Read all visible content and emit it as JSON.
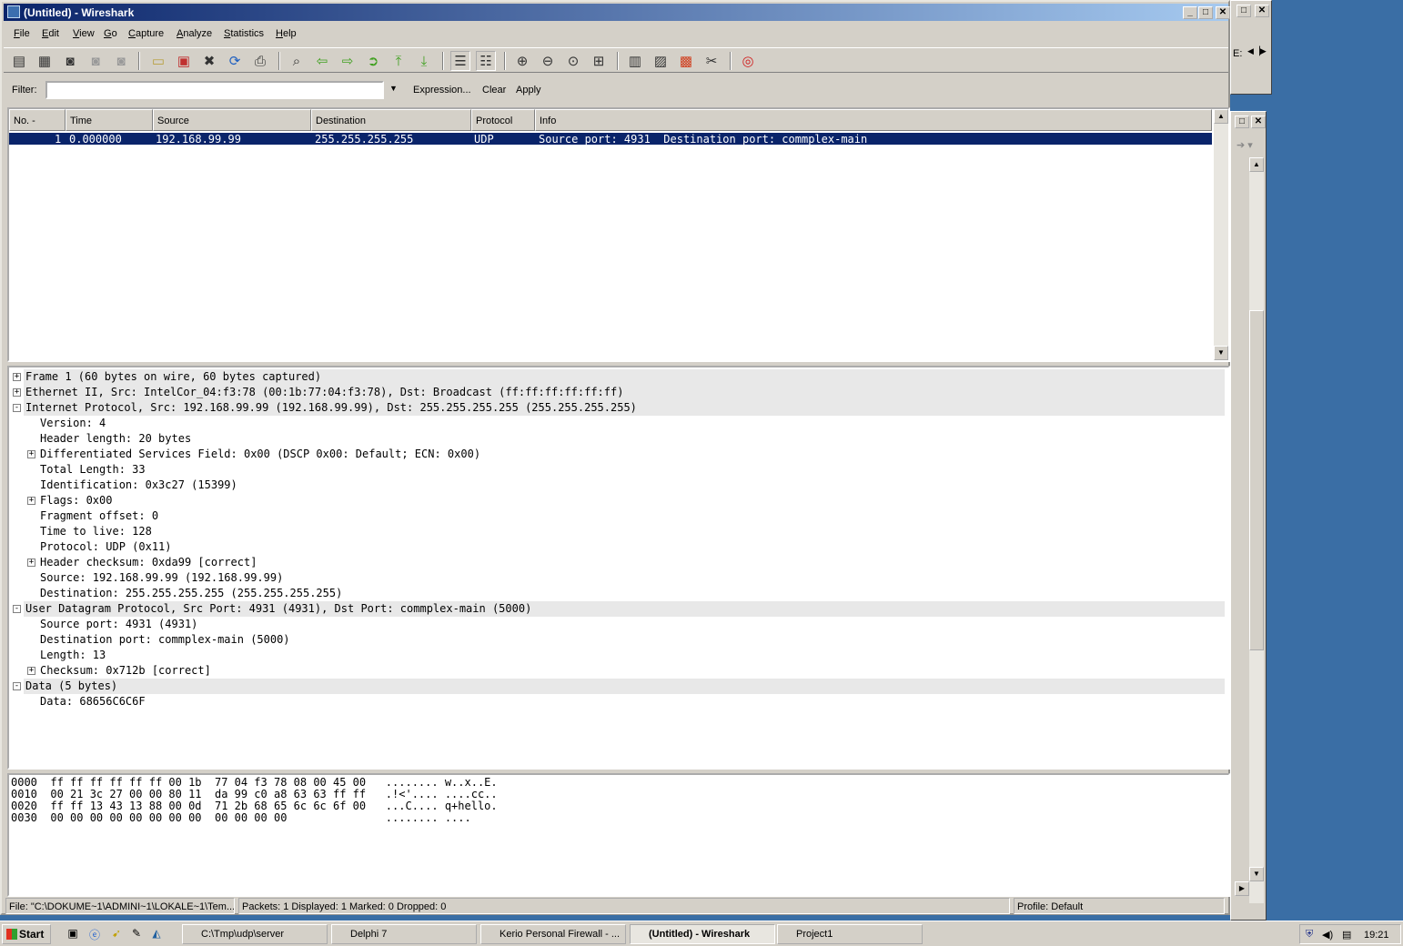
{
  "window": {
    "title": "(Untitled) - Wireshark"
  },
  "menu": [
    "File",
    "Edit",
    "View",
    "Go",
    "Capture",
    "Analyze",
    "Statistics",
    "Help"
  ],
  "toolbar_icons": [
    "interface-list-icon",
    "capture-options-icon",
    "capture-start-icon",
    "capture-stop-icon",
    "capture-restart-icon",
    "open-icon",
    "save-icon",
    "close-icon",
    "reload-icon",
    "print-icon",
    "find-icon",
    "go-back-icon",
    "go-forward-icon",
    "go-to-packet-icon",
    "go-first-icon",
    "go-last-icon",
    "colorize-icon",
    "auto-scroll-icon",
    "zoom-in-icon",
    "zoom-out-icon",
    "zoom-normal-icon",
    "resize-columns-icon",
    "capture-filters-icon",
    "display-filters-icon",
    "coloring-rules-icon",
    "preferences-icon",
    "help-icon"
  ],
  "filter": {
    "label": "Filter:",
    "value": "",
    "expression": "Expression...",
    "clear": "Clear",
    "apply": "Apply"
  },
  "packet_list": {
    "columns": [
      "No. -",
      "Time",
      "Source",
      "Destination",
      "Protocol",
      "Info"
    ],
    "rows": [
      {
        "no": "1",
        "time": "0.000000",
        "source": "192.168.99.99",
        "destination": "255.255.255.255",
        "protocol": "UDP",
        "info": "Source port: 4931  Destination port: commplex-main"
      }
    ]
  },
  "details": [
    {
      "text": "Frame 1 (60 bytes on wire, 60 bytes captured)",
      "level": 0,
      "toggle": "+",
      "hl": true
    },
    {
      "text": "Ethernet II, Src: IntelCor_04:f3:78 (00:1b:77:04:f3:78), Dst: Broadcast (ff:ff:ff:ff:ff:ff)",
      "level": 0,
      "toggle": "+",
      "hl": true
    },
    {
      "text": "Internet Protocol, Src: 192.168.99.99 (192.168.99.99), Dst: 255.255.255.255 (255.255.255.255)",
      "level": 0,
      "toggle": "-",
      "hl": true
    },
    {
      "text": "Version: 4",
      "level": 1,
      "toggle": ""
    },
    {
      "text": "Header length: 20 bytes",
      "level": 1,
      "toggle": ""
    },
    {
      "text": "Differentiated Services Field: 0x00 (DSCP 0x00: Default; ECN: 0x00)",
      "level": 1,
      "toggle": "+"
    },
    {
      "text": "Total Length: 33",
      "level": 1,
      "toggle": ""
    },
    {
      "text": "Identification: 0x3c27 (15399)",
      "level": 1,
      "toggle": ""
    },
    {
      "text": "Flags: 0x00",
      "level": 1,
      "toggle": "+"
    },
    {
      "text": "Fragment offset: 0",
      "level": 1,
      "toggle": ""
    },
    {
      "text": "Time to live: 128",
      "level": 1,
      "toggle": ""
    },
    {
      "text": "Protocol: UDP (0x11)",
      "level": 1,
      "toggle": ""
    },
    {
      "text": "Header checksum: 0xda99 [correct]",
      "level": 1,
      "toggle": "+"
    },
    {
      "text": "Source: 192.168.99.99 (192.168.99.99)",
      "level": 1,
      "toggle": ""
    },
    {
      "text": "Destination: 255.255.255.255 (255.255.255.255)",
      "level": 1,
      "toggle": ""
    },
    {
      "text": "User Datagram Protocol, Src Port: 4931 (4931), Dst Port: commplex-main (5000)",
      "level": 0,
      "toggle": "-",
      "hl": true
    },
    {
      "text": "Source port: 4931 (4931)",
      "level": 1,
      "toggle": ""
    },
    {
      "text": "Destination port: commplex-main (5000)",
      "level": 1,
      "toggle": ""
    },
    {
      "text": "Length: 13",
      "level": 1,
      "toggle": ""
    },
    {
      "text": "Checksum: 0x712b [correct]",
      "level": 1,
      "toggle": "+"
    },
    {
      "text": "Data (5 bytes)",
      "level": 0,
      "toggle": "-",
      "hl": true
    },
    {
      "text": "Data: 68656C6C6F",
      "level": 1,
      "toggle": ""
    }
  ],
  "bytes": [
    "0000  ff ff ff ff ff ff 00 1b  77 04 f3 78 08 00 45 00   ........ w..x..E.",
    "0010  00 21 3c 27 00 00 80 11  da 99 c0 a8 63 63 ff ff   .!<'.... ....cc..",
    "0020  ff ff 13 43 13 88 00 0d  71 2b 68 65 6c 6c 6f 00   ...C.... q+hello.",
    "0030  00 00 00 00 00 00 00 00  00 00 00 00               ........ ...."
  ],
  "status": {
    "file": "File: \"C:\\DOKUME~1\\ADMINI~1\\LOKALE~1\\Tem...",
    "packets": "Packets: 1 Displayed: 1 Marked: 0 Dropped: 0",
    "profile": "Profile: Default"
  },
  "taskbar": {
    "start": "Start",
    "tasks": [
      "C:\\Tmp\\udp\\server",
      "Delphi 7",
      "Kerio Personal Firewall - ...",
      "(Untitled) - Wireshark",
      "Project1"
    ],
    "active": "(Untitled) - Wireshark",
    "clock": "19:21"
  },
  "bg_window": {
    "text": "E:"
  }
}
